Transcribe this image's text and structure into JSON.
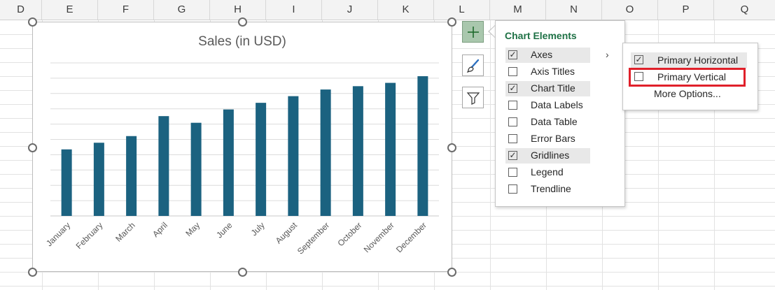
{
  "columns": [
    "D",
    "E",
    "F",
    "G",
    "H",
    "I",
    "J",
    "K",
    "L",
    "M",
    "N",
    "O",
    "P",
    "Q"
  ],
  "chart_data": {
    "type": "bar",
    "title": "Sales (in USD)",
    "categories": [
      "January",
      "February",
      "March",
      "April",
      "May",
      "June",
      "July",
      "August",
      "September",
      "October",
      "November",
      "December"
    ],
    "values": [
      1000,
      1100,
      1200,
      1500,
      1400,
      1600,
      1700,
      1800,
      1900,
      1950,
      2000,
      2100
    ],
    "ylim": [
      0,
      2300
    ],
    "grid": true,
    "bar_color": "#1b6280",
    "gridline_count": 10
  },
  "chart_elements": {
    "title": "Chart Elements",
    "items": [
      {
        "label": "Axes",
        "checked": true,
        "highlighted": true
      },
      {
        "label": "Axis Titles",
        "checked": false,
        "highlighted": false
      },
      {
        "label": "Chart Title",
        "checked": true,
        "highlighted": true
      },
      {
        "label": "Data Labels",
        "checked": false,
        "highlighted": false
      },
      {
        "label": "Data Table",
        "checked": false,
        "highlighted": false
      },
      {
        "label": "Error Bars",
        "checked": false,
        "highlighted": false
      },
      {
        "label": "Gridlines",
        "checked": true,
        "highlighted": true
      },
      {
        "label": "Legend",
        "checked": false,
        "highlighted": false
      },
      {
        "label": "Trendline",
        "checked": false,
        "highlighted": false
      }
    ],
    "chevron": "›"
  },
  "axes_submenu": {
    "items": [
      {
        "label": "Primary Horizontal",
        "checked": true
      },
      {
        "label": "Primary Vertical",
        "checked": false
      }
    ],
    "more_options": "More Options..."
  },
  "side_buttons": [
    "plus-icon",
    "brush-icon",
    "funnel-icon"
  ],
  "colors": {
    "accent_green": "#1e7145",
    "highlight_red": "#e0202a",
    "bar": "#1b6280"
  }
}
